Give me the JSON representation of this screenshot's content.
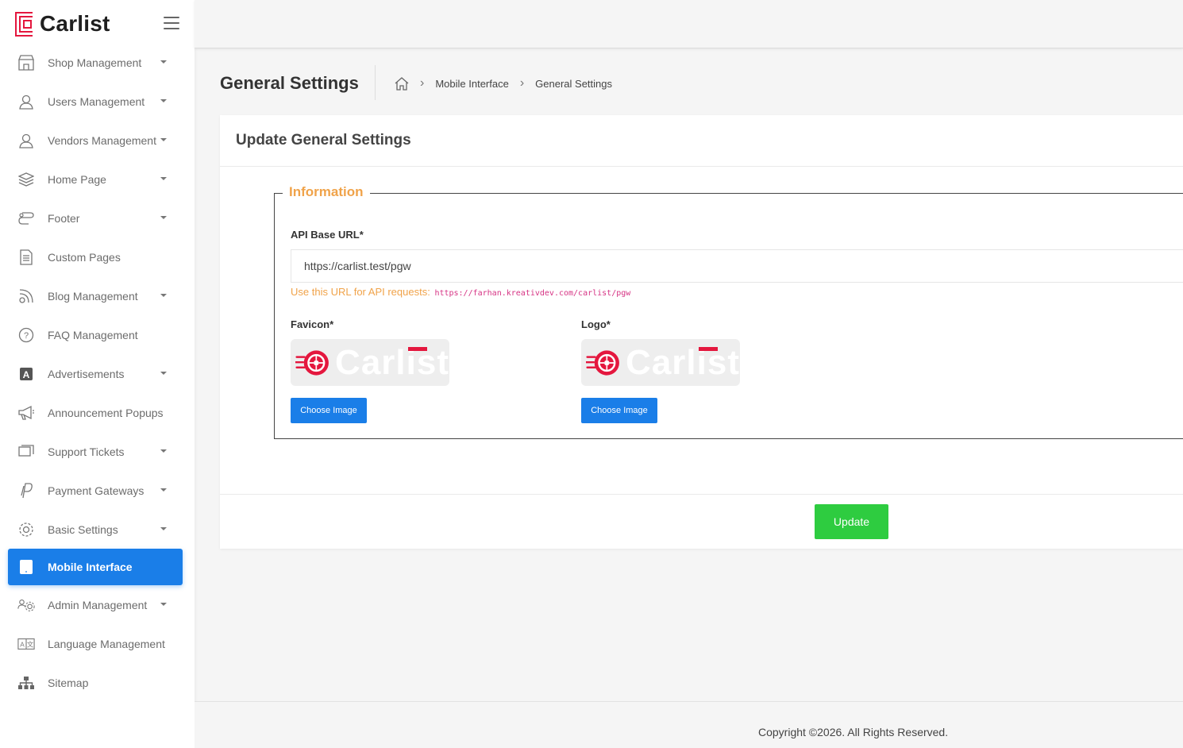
{
  "brand": {
    "name": "Carlist"
  },
  "sidebar": {
    "items": [
      {
        "label": "Shop Management",
        "icon": "shop-icon",
        "caret": true
      },
      {
        "label": "Users Management",
        "icon": "users-icon",
        "caret": true
      },
      {
        "label": "Vendors Management",
        "icon": "vendors-icon",
        "caret": true
      },
      {
        "label": "Home Page",
        "icon": "layers-icon",
        "caret": true
      },
      {
        "label": "Footer",
        "icon": "footer-icon",
        "caret": true
      },
      {
        "label": "Custom Pages",
        "icon": "document-icon",
        "caret": false
      },
      {
        "label": "Blog Management",
        "icon": "blog-icon",
        "caret": true
      },
      {
        "label": "FAQ Management",
        "icon": "question-icon",
        "caret": false
      },
      {
        "label": "Advertisements",
        "icon": "ad-icon",
        "caret": true
      },
      {
        "label": "Announcement Popups",
        "icon": "megaphone-icon",
        "caret": false
      },
      {
        "label": "Support Tickets",
        "icon": "ticket-icon",
        "caret": true
      },
      {
        "label": "Payment Gateways",
        "icon": "paypal-icon",
        "caret": true
      },
      {
        "label": "Basic Settings",
        "icon": "gear-icon",
        "caret": true
      },
      {
        "label": "Mobile Interface",
        "icon": "tablet-icon",
        "caret": false,
        "active": true
      },
      {
        "label": "Admin Management",
        "icon": "admin-icon",
        "caret": true
      },
      {
        "label": "Language Management",
        "icon": "language-icon",
        "caret": false
      },
      {
        "label": "Sitemap",
        "icon": "sitemap-icon",
        "caret": false
      }
    ]
  },
  "header": {
    "title": "General Settings",
    "breadcrumb": [
      "Mobile Interface",
      "General Settings"
    ]
  },
  "card": {
    "title": "Update General Settings",
    "legend": "Information",
    "api_label": "API Base URL*",
    "api_value": "https://carlist.test/pgw",
    "hint_text": "Use this URL for API requests:",
    "hint_url": "https://farhan.kreativdev.com/carlist/pgw",
    "favicon_label": "Favicon*",
    "logo_label": "Logo*",
    "image_wordmark": "Carlist",
    "choose_label": "Choose Image",
    "update_label": "Update"
  },
  "footer": {
    "copyright": "Copyright ©2026. All Rights Reserved."
  },
  "colors": {
    "primary": "#1a7ee8",
    "success": "#2ecc40",
    "accent": "#f0a34a",
    "brand_red": "#e4173e"
  }
}
